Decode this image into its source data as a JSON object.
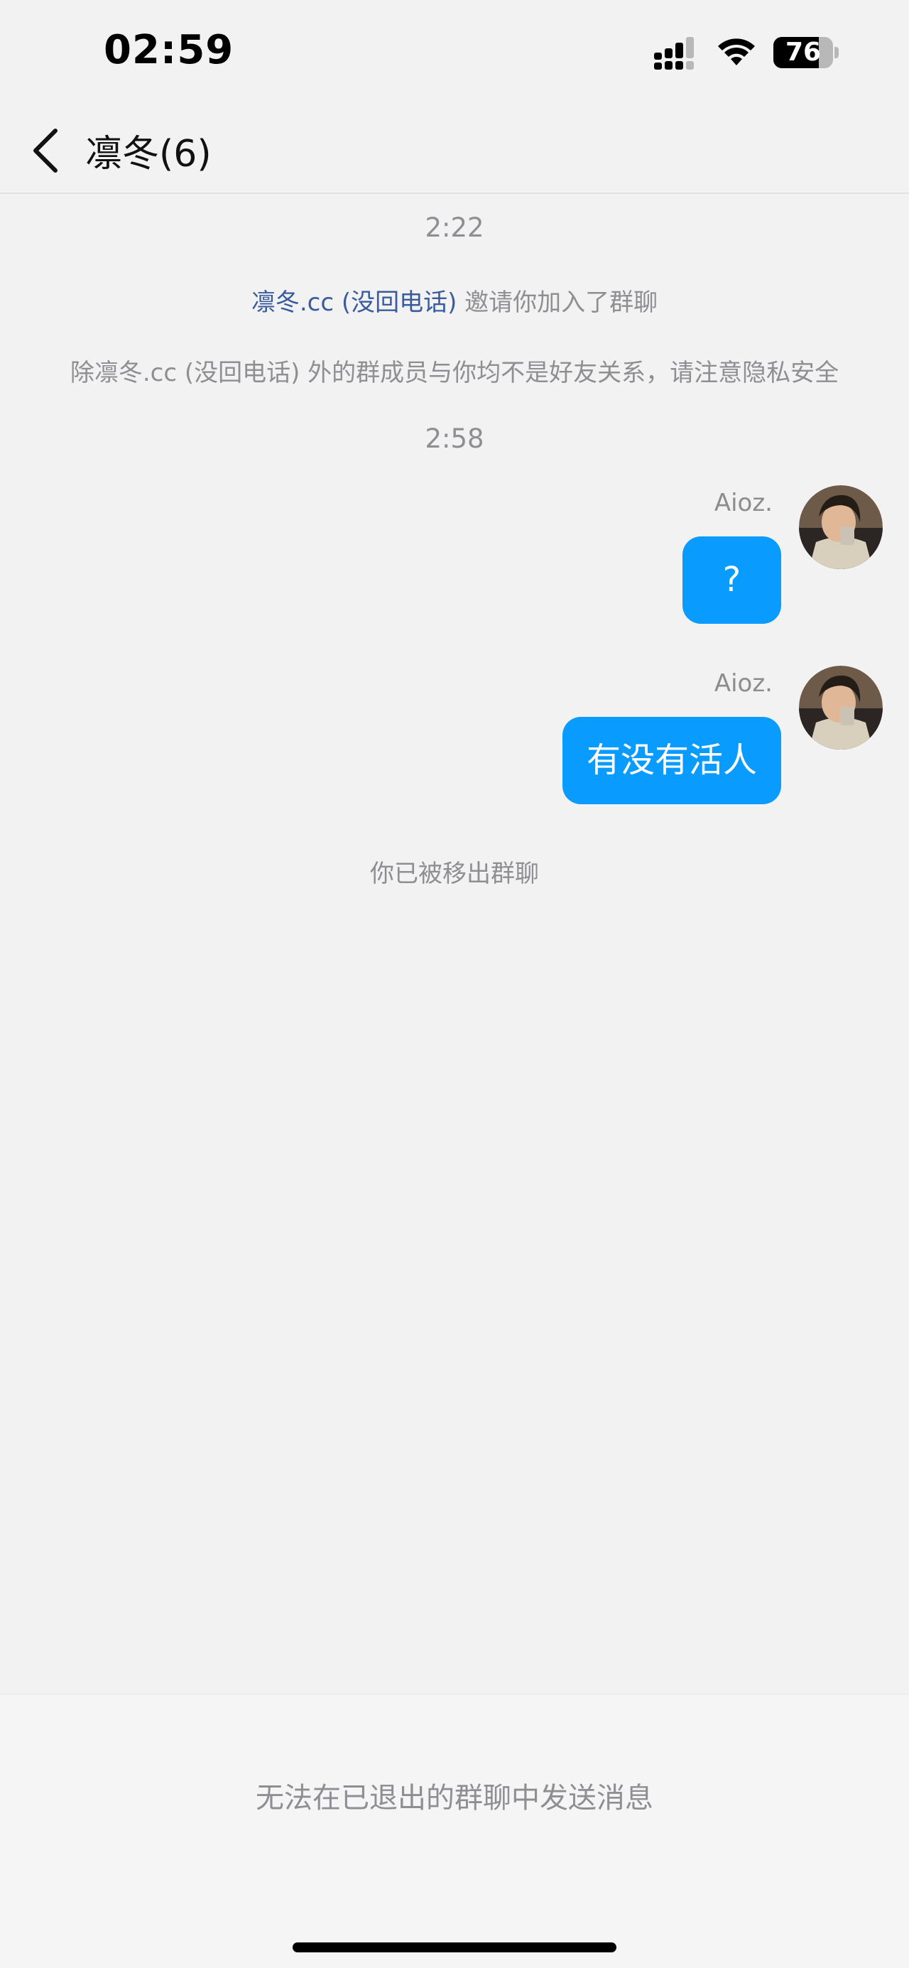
{
  "status_bar": {
    "time": "02:59",
    "battery_percent": "76",
    "battery_level": 0.76
  },
  "header": {
    "title": "凛冬(6)",
    "back_icon": "chevron-left-icon"
  },
  "messages": {
    "timestamp_1": "2:22",
    "invite": {
      "inviter": "凛冬.cc (没回电话)",
      "text": " 邀请你加入了群聊"
    },
    "privacy_notice": "除凛冬.cc (没回电话) 外的群成员与你均不是好友关系，请注意隐私安全",
    "timestamp_2": "2:58",
    "chat": [
      {
        "sender": "Aioz.",
        "text": "?"
      },
      {
        "sender": "Aioz.",
        "text": "有没有活人"
      }
    ],
    "removed_notice": "你已被移出群聊"
  },
  "footer": {
    "notice": "无法在已退出的群聊中发送消息"
  },
  "colors": {
    "bubble": "#0a9bff",
    "link": "#3a5c9c",
    "background": "#f2f2f3"
  }
}
